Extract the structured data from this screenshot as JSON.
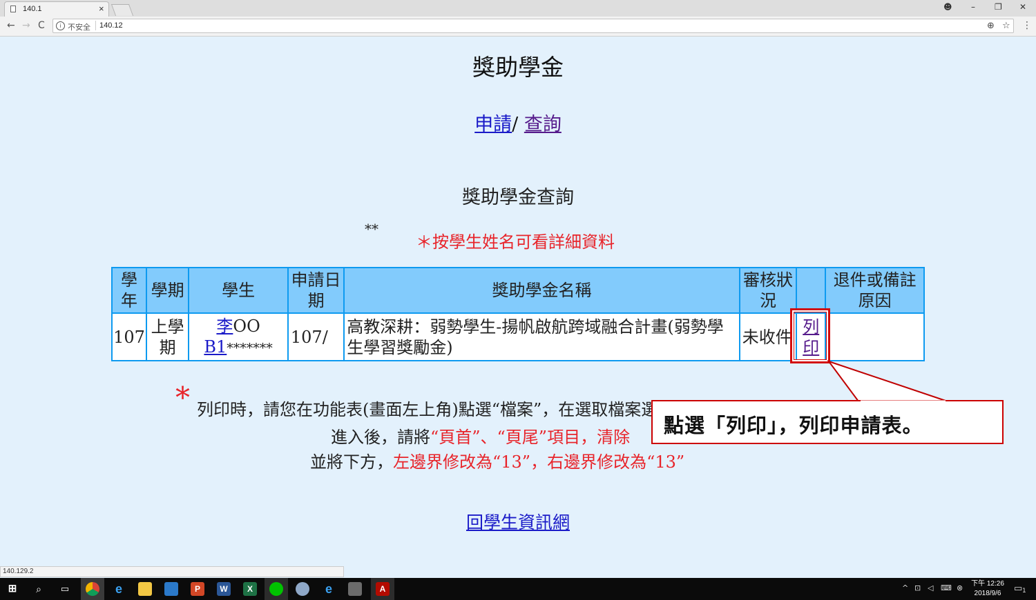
{
  "browser": {
    "tab_title": "140.1",
    "tab_close": "×",
    "insecure_label": "不安全",
    "url": "140.12",
    "status_url": "140.129.2",
    "controls": {
      "account": "☻",
      "minimize": "–",
      "restore": "❐",
      "close": "✕"
    },
    "nav": {
      "back": "←",
      "forward": "→",
      "reload": "C"
    },
    "omni_icons": {
      "zoom": "⊕",
      "star": "☆",
      "menu": "⋮"
    }
  },
  "page": {
    "title": "獎助學金",
    "nav": {
      "apply": "申請",
      "separator": "/ ",
      "query": "查詢"
    },
    "section_title": "獎助學金查詢",
    "stars": "**",
    "hint": "＊按學生姓名可看詳細資料",
    "table": {
      "headers": {
        "year": "學年",
        "semester": "學期",
        "student": "學生",
        "apply_date": "申請日期",
        "scholarship_name": "獎助學金名稱",
        "review_status": "審核狀況",
        "action": "",
        "remarks": "退件或備註原因"
      },
      "row": {
        "year": "107",
        "semester": "上學期",
        "student_surname": "李",
        "student_given": "OO",
        "student_id": "B1",
        "student_id_mask": "*******",
        "apply_date": "107/",
        "scholarship_name": "高教深耕：弱勢學生-揚帆啟航跨域融合計畫(弱勢學生學習獎勵金)",
        "review_status": "未收件",
        "print_link": "列印",
        "remarks": ""
      }
    },
    "notes": {
      "star": "*",
      "line1": "列印時，請您在功能表(畫面左上角)點選“檔案”，在選取檔案選單中的“設定列印格式”",
      "line2_a": "進入後，請將",
      "line2_b": "“頁首”、“頁尾”項目，清除",
      "line3_a": "並將下方，",
      "line3_b": "左邊界修改為“13”，右邊界修改為“13”"
    },
    "back_link": "回學生資訊網"
  },
  "callout": {
    "text": "點選「列印」，列印申請表。",
    "border_color": "#cc0000"
  },
  "taskbar": {
    "clock_time": "下午 12:26",
    "clock_date": "2018/9/6",
    "apps": [
      "start-icon",
      "search-icon",
      "task-view-icon",
      "chrome-icon",
      "edge-icon",
      "file-explorer-icon",
      "remote-desktop-icon",
      "powerpoint-icon",
      "word-icon",
      "excel-icon",
      "line-icon",
      "network-icon",
      "ie-icon",
      "app-icon",
      "acrobat-icon"
    ],
    "tray": {
      "chevron": "^",
      "network": "⊡",
      "volume": "◁",
      "keyboard": "⌨",
      "close": "⊗",
      "notification": "▭"
    },
    "notification_count": "1"
  }
}
